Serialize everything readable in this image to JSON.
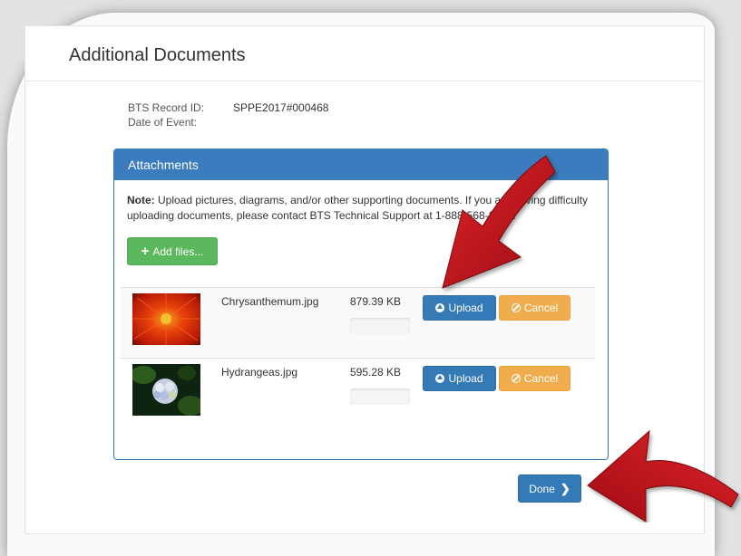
{
  "page": {
    "title": "Additional Documents"
  },
  "record": {
    "id_label": "BTS Record ID:",
    "id_value": "SPPE2017#000468",
    "date_label": "Date of Event:",
    "date_value": ""
  },
  "attachments": {
    "heading": "Attachments",
    "note_label": "Note:",
    "note_text": " Upload pictures, diagrams, and/or other supporting documents. If you are having difficulty uploading documents, please contact BTS Technical Support at 1-888-568-2377.",
    "add_files_label": "Add files...",
    "add_files_icon": "plus-icon",
    "files": [
      {
        "name": "Chrysanthemum.jpg",
        "size": "879.39 KB",
        "progress": 0,
        "upload_label": "Upload",
        "cancel_label": "Cancel",
        "thumb": "chrysanthemum"
      },
      {
        "name": "Hydrangeas.jpg",
        "size": "595.28 KB",
        "progress": 0,
        "upload_label": "Upload",
        "cancel_label": "Cancel",
        "thumb": "hydrangeas"
      }
    ]
  },
  "footer": {
    "done_label": "Done"
  },
  "colors": {
    "primary": "#337ab7",
    "success": "#5cb85c",
    "warning": "#f0ad4e",
    "annotation_arrow": "#c8101a"
  },
  "icons": [
    "plus-icon",
    "upload-circle-icon",
    "ban-icon",
    "chevron-right-icon"
  ]
}
